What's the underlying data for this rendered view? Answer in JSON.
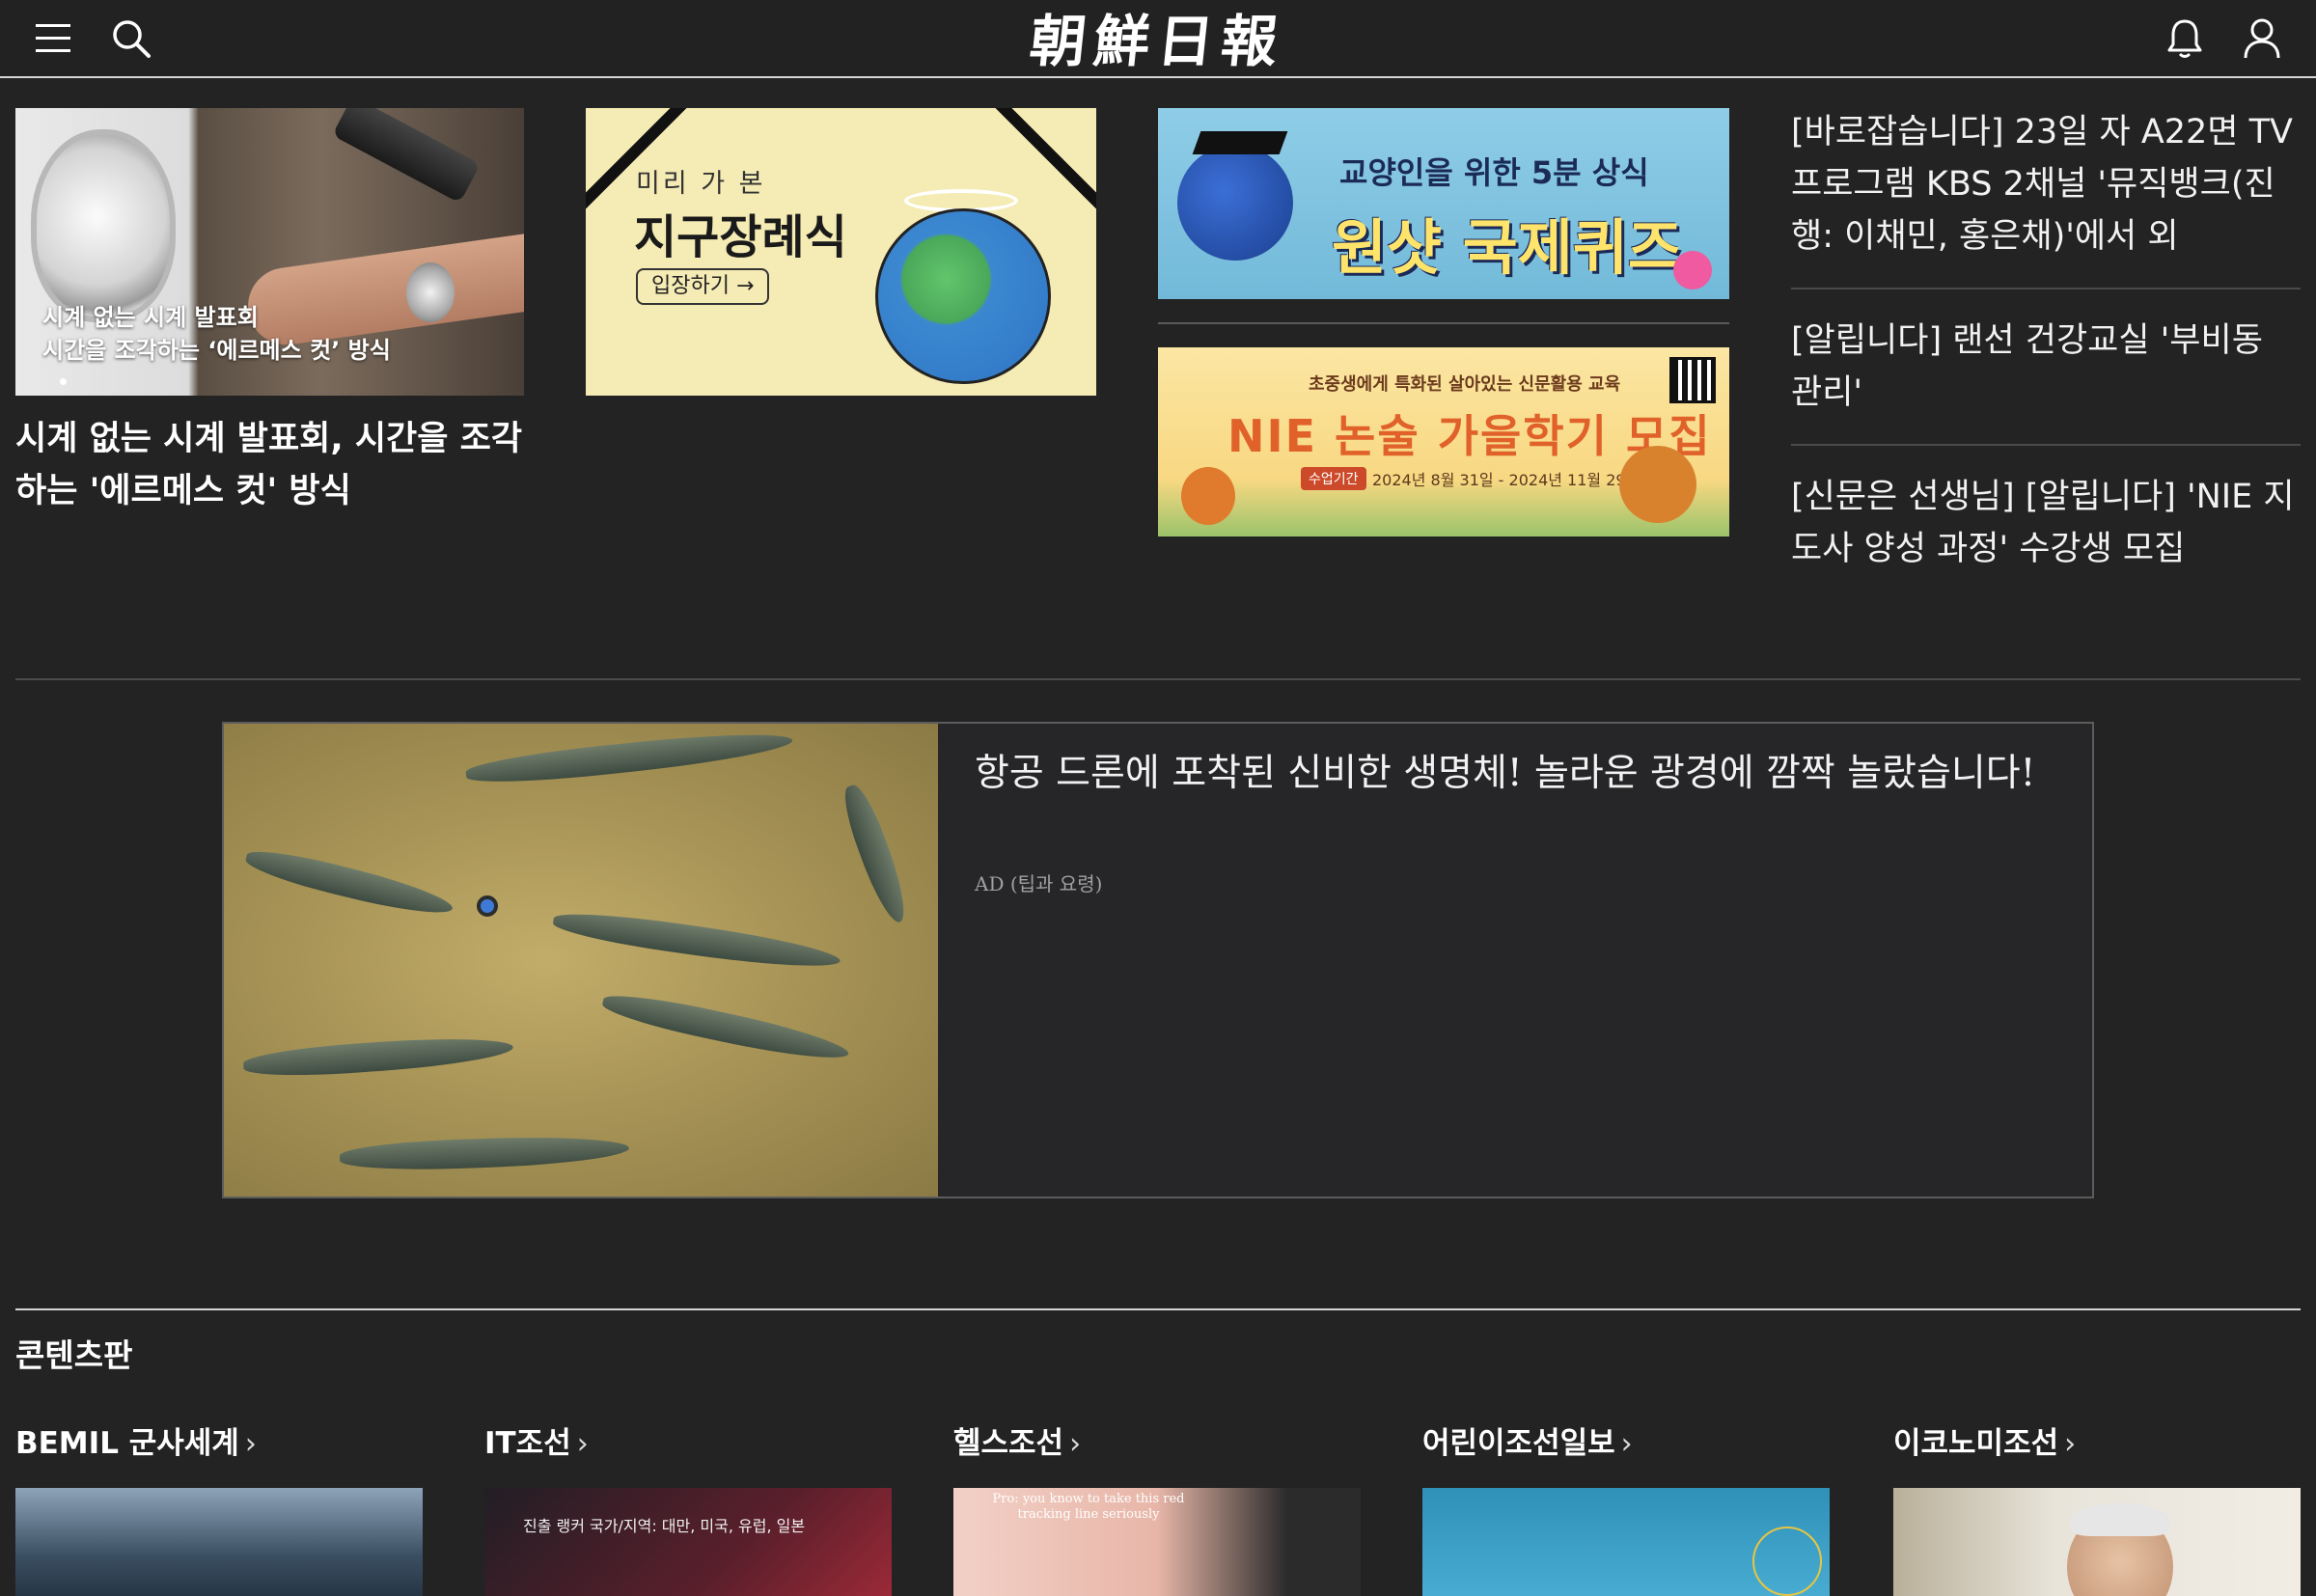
{
  "header": {
    "logo_text": "朝鮮日報",
    "icons": [
      "menu-icon",
      "search-icon",
      "bell-icon",
      "user-icon"
    ]
  },
  "top_row": {
    "feature_card": {
      "overlay_line1": "시계 없는 시계 발표회",
      "overlay_line2": "시간을 조각하는 ‘에르메스 컷’ 방식",
      "headline": "시계 없는 시계 발표회, 시간을 조각하는 '에르메스 컷' 방식"
    },
    "funeral_banner": {
      "small_text": "미리 가 본",
      "big_text": "지구장례식",
      "button_text": "입장하기 →"
    },
    "quiz_banner": {
      "sub_text": "교양인을 위한 5분 상식",
      "main_text": "원샷 국제퀴즈"
    },
    "nie_banner": {
      "sub_text": "초중생에게 특화된 살아있는 신문활용 교육",
      "main_text": "NIE 논술 가을학기 모집",
      "tag_text": "수업기간",
      "date_text": "2024년 8월 31일 - 2024년 11월 29일"
    },
    "notices": [
      "[바로잡습니다] 23일 자 A22면 TV 프로그램 KBS 2채널 '뮤직뱅크(진행: 이채민, 홍은채)'에서 외",
      "[알립니다] 랜선 건강교실 '부비동 관리'",
      "[신문은 선생님] [알립니다] 'NIE 지도사 양성 과정' 수강생 모집"
    ]
  },
  "ad": {
    "title": "항공 드론에 포착된 신비한 생명체! 놀라운 광경에 깜짝 놀랐습니다!",
    "source": "AD (팁과 요령)"
  },
  "contents_section": {
    "title": "콘텐츠판",
    "categories": [
      {
        "label": "BEMIL 군사세계",
        "chevron": "›"
      },
      {
        "label": "IT조선",
        "chevron": "›"
      },
      {
        "label": "헬스조선",
        "chevron": "›"
      },
      {
        "label": "어린이조선일보",
        "chevron": "›"
      },
      {
        "label": "이코노미조선",
        "chevron": "›"
      }
    ],
    "thumb_captions": {
      "it": "진출 랭커 국가/지역: 대만, 미국, 유럽, 일본",
      "health": "Pro: you know to take this red tracking line seriously"
    }
  },
  "colors": {
    "background": "#232323",
    "header_rule": "#d6d6d6",
    "text": "#f2f2f2"
  }
}
